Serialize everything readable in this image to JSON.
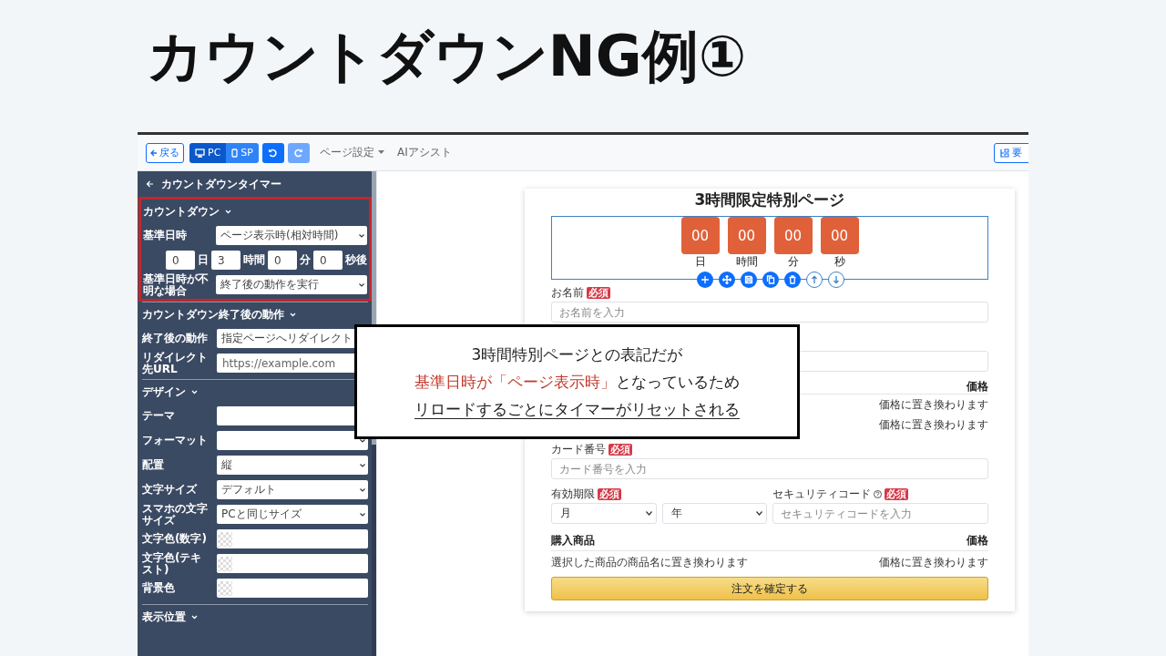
{
  "title": "カウントダウンNG例①",
  "toolbar": {
    "back": "戻る",
    "devices": [
      {
        "label": "PC",
        "selected": true
      },
      {
        "label": "SP",
        "selected": false
      }
    ],
    "undo": {
      "disabled": false
    },
    "redo": {
      "disabled": true
    },
    "menus": [
      {
        "label": "ページ設定",
        "dropdown": true
      },
      {
        "label": "AIアシスト",
        "dropdown": false
      }
    ],
    "right_button": "要"
  },
  "sidebar": {
    "header": "カウントダウンタイマー",
    "sections": [
      {
        "title": "カウントダウン",
        "expanded": true,
        "highlighted": true,
        "rows": [
          {
            "kind": "select",
            "label": "基準日時",
            "value": "ページ表示時(相対時間)"
          },
          {
            "kind": "duration",
            "parts": [
              {
                "value": "0",
                "unit": "日"
              },
              {
                "value": "3",
                "unit": "時間"
              },
              {
                "value": "0",
                "unit": "分"
              },
              {
                "value": "0",
                "unit": "秒後"
              }
            ]
          },
          {
            "kind": "select",
            "label": "基準日時が不明な場合",
            "value": "終了後の動作を実行"
          }
        ]
      },
      {
        "title": "カウントダウン終了後の動作",
        "expanded": true,
        "highlighted": false,
        "rows": [
          {
            "kind": "select",
            "label": "終了後の動作",
            "value": "指定ページへリダイレクト"
          },
          {
            "kind": "input",
            "label": "リダイレクト先URL",
            "placeholder": "https://example.com"
          }
        ]
      },
      {
        "title": "デザイン",
        "expanded": true,
        "highlighted": false,
        "rows": [
          {
            "kind": "select",
            "label": "テーマ"
          },
          {
            "kind": "select",
            "label": "フォーマット"
          },
          {
            "kind": "select",
            "label": "配置",
            "value": "縦"
          },
          {
            "kind": "select",
            "label": "文字サイズ",
            "value": "デフォルト"
          },
          {
            "kind": "select",
            "label": "スマホの文字サイズ",
            "value": "PCと同じサイズ"
          },
          {
            "kind": "color",
            "label": "文字色(数字)"
          },
          {
            "kind": "color",
            "label": "文字色(テキスト)"
          },
          {
            "kind": "color",
            "label": "背景色"
          }
        ]
      },
      {
        "title": "表示位置",
        "expanded": true,
        "highlighted": false
      }
    ]
  },
  "page": {
    "title": "3時間限定特別ページ",
    "countdown": [
      {
        "value": "00",
        "unit": "日"
      },
      {
        "value": "00",
        "unit": "時間"
      },
      {
        "value": "00",
        "unit": "分"
      },
      {
        "value": "00",
        "unit": "秒"
      }
    ],
    "element_actions": [
      {
        "disabled": false
      },
      {
        "disabled": false
      },
      {
        "disabled": false
      },
      {
        "disabled": false
      },
      {
        "disabled": false
      },
      {
        "disabled": true
      },
      {
        "disabled": true
      }
    ],
    "name_field": {
      "label": "お名前",
      "badge": "必須",
      "placeholder": "お名前を入力"
    },
    "field_2": {
      "kind": "input"
    },
    "price_summary": {
      "header": "価格",
      "prices": [
        "価格に置き換わります",
        "価格に置き換わります"
      ]
    },
    "card_number": {
      "label": "カード番号",
      "badge": "必須",
      "placeholder": "カード番号を入力"
    },
    "expiry": {
      "label": "有効期限",
      "badge": "必須",
      "month": "月",
      "year": "年"
    },
    "security_code": {
      "label": "セキュリティコード",
      "badge": "必須",
      "placeholder": "セキュリティコードを入力"
    },
    "products": {
      "columns": [
        "購入商品",
        "価格"
      ],
      "rows": [
        [
          "選択した商品の商品名に置き換わります",
          "価格に置き換わります"
        ]
      ]
    },
    "submit": "注文を確定する"
  },
  "note": {
    "lines": [
      {
        "underline": false,
        "segments": [
          {
            "text": "3時間特別ページとの表記だが",
            "emphasis": false
          }
        ]
      },
      {
        "underline": false,
        "segments": [
          {
            "text": "基準日時が「ページ表示時」",
            "emphasis": true
          },
          {
            "text": "となっているため",
            "emphasis": false
          }
        ]
      },
      {
        "underline": true,
        "segments": [
          {
            "text": "リロードするごとにタイマーがリセットされる",
            "emphasis": false
          }
        ]
      }
    ]
  }
}
